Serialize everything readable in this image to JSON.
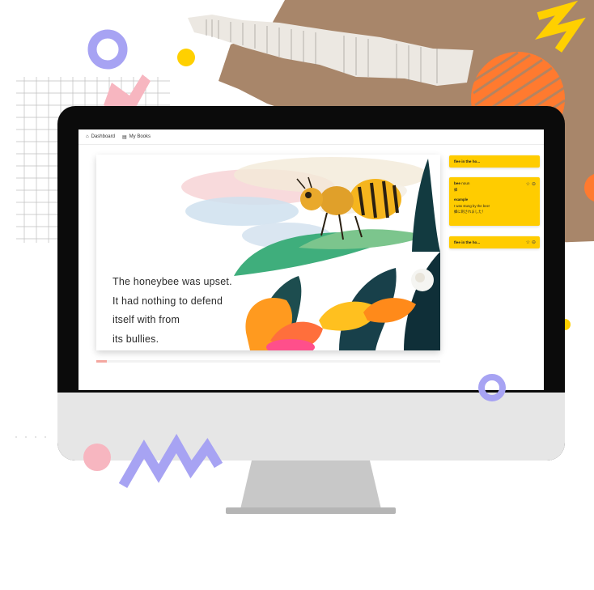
{
  "nav": {
    "dashboard_label": "Dashboard",
    "mybooks_label": "My Books"
  },
  "book": {
    "story_lines": [
      "The honeybee was upset.",
      "It had nothing to defend",
      "itself with from",
      "its bullies."
    ],
    "progress": 0.03
  },
  "cards": [
    {
      "title": "flee in the ho..."
    },
    {
      "word": "bee",
      "part_of_speech": "noun",
      "translation": "蜂",
      "example_label": "example",
      "example_en": "I was stung by the bee!",
      "example_ja": "蜂に刺されました！"
    },
    {
      "title": "flee in the ho..."
    }
  ],
  "colors": {
    "card_yellow": "#ffcc00",
    "bezel": "#0b0b0b",
    "chin": "#e6e6e6",
    "confetti_purple": "#a7a3f3",
    "confetti_pink": "#f7b6c0",
    "confetti_yellow": "#ffd000",
    "confetti_orange": "#ff7a2f",
    "kraft": "#a8866a"
  },
  "icons": {
    "dashboard": "home-icon",
    "mybooks": "books-icon",
    "star": "star-outline-icon",
    "remove": "minus-circle-icon"
  }
}
